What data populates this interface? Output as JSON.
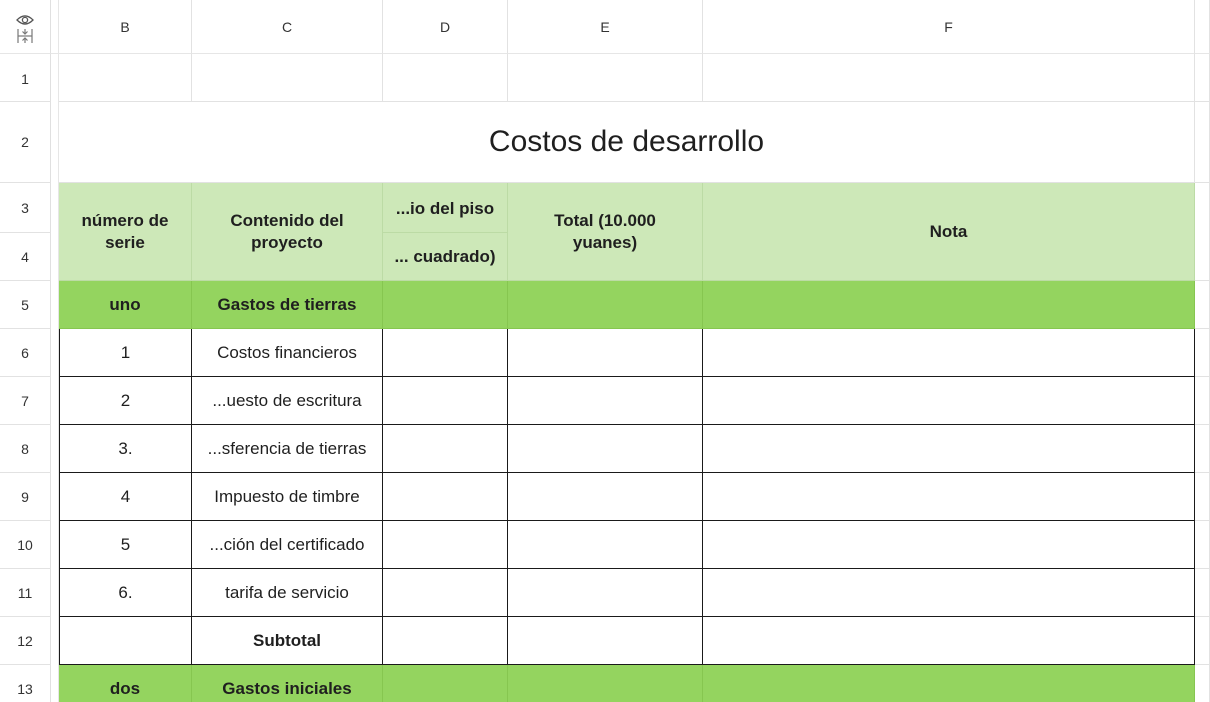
{
  "columns": [
    "B",
    "C",
    "D",
    "E",
    "F"
  ],
  "rows": [
    "1",
    "2",
    "3",
    "4",
    "5",
    "6",
    "7",
    "8",
    "9",
    "10",
    "11",
    "12",
    "13"
  ],
  "title": "Costos de desarrollo",
  "header": {
    "serie": "número de serie",
    "contenido": "Contenido del proyecto",
    "piso_top": "...io del piso",
    "piso_bottom": "... cuadrado)",
    "total": "Total (10.000 yuanes)",
    "nota": "Nota"
  },
  "section1": {
    "num": "uno",
    "label": "Gastos de tierras"
  },
  "items": [
    {
      "num": "1",
      "label": "Costos financieros"
    },
    {
      "num": "2",
      "label": "...uesto de escritura"
    },
    {
      "num": "3.",
      "label": "...sferencia de tierras"
    },
    {
      "num": "4",
      "label": "Impuesto de timbre"
    },
    {
      "num": "5",
      "label": "...ción del certificado"
    },
    {
      "num": "6.",
      "label": "tarifa de servicio"
    }
  ],
  "subtotal": "Subtotal",
  "section2": {
    "num": "dos",
    "label": "Gastos iniciales"
  },
  "icons": {
    "visibility": "eye-icon",
    "freeze": "freeze-rows-icon"
  },
  "colors": {
    "header_light_green": "#cde8b8",
    "section_green": "#94d45f"
  }
}
